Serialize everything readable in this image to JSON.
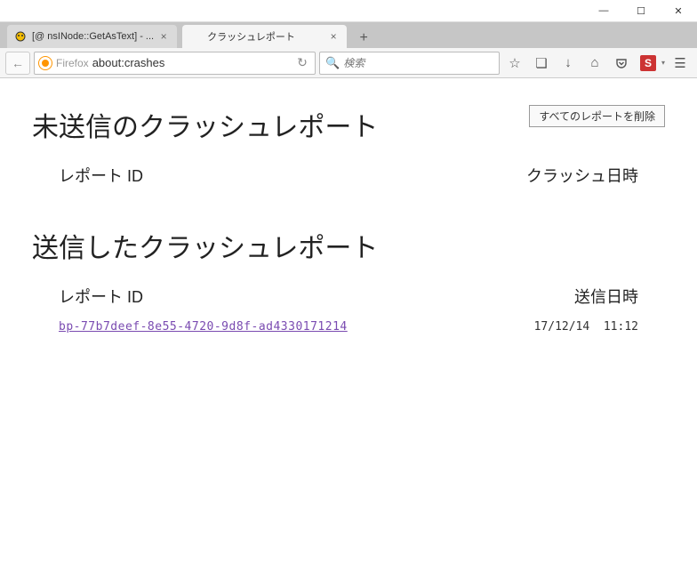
{
  "window": {
    "minimize": "—",
    "maximize": "☐",
    "close": "✕"
  },
  "tabs": [
    {
      "title": "[@ nsINode::GetAsText] - ...",
      "favicon": "bug"
    },
    {
      "title": "クラッシュレポート",
      "favicon": ""
    }
  ],
  "toolbar": {
    "back": "←",
    "firefox_label": "Firefox",
    "url": "about:crashes",
    "reload": "↻",
    "search_placeholder": "検索",
    "star": "☆",
    "library": "❏",
    "download": "↓",
    "home": "⌂",
    "pocket": "⌄",
    "stylish": "S",
    "menu": "☰"
  },
  "page": {
    "unsent_heading": "未送信のクラッシュレポート",
    "remove_all_label": "すべてのレポートを削除",
    "col_report_id": "レポート ID",
    "col_crash_date": "クラッシュ日時",
    "sent_heading": "送信したクラッシュレポート",
    "col_sent_date": "送信日時",
    "reports": [
      {
        "id": "bp-77b7deef-8e55-4720-9d8f-ad4330171214",
        "date": "17/12/14  11:12"
      }
    ]
  }
}
